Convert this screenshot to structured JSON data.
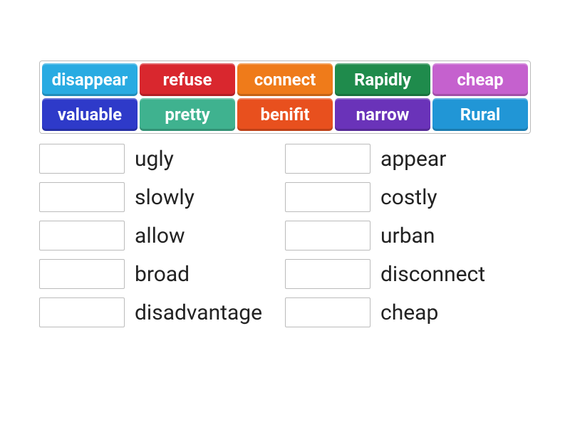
{
  "word_bank": {
    "rows": [
      [
        {
          "label": "disappear",
          "color": "c-lightblue"
        },
        {
          "label": "refuse",
          "color": "c-red"
        },
        {
          "label": "connect",
          "color": "c-orange"
        },
        {
          "label": "Rapidly",
          "color": "c-green"
        },
        {
          "label": "cheap",
          "color": "c-magenta"
        }
      ],
      [
        {
          "label": "valuable",
          "color": "c-indigo"
        },
        {
          "label": "pretty",
          "color": "c-teal"
        },
        {
          "label": "benifit",
          "color": "c-orangered"
        },
        {
          "label": "narrow",
          "color": "c-purple"
        },
        {
          "label": "Rural",
          "color": "c-skyblue"
        }
      ]
    ]
  },
  "targets": {
    "left": [
      "ugly",
      "slowly",
      "allow",
      "broad",
      "disadvantage"
    ],
    "right": [
      "appear",
      "costly",
      "urban",
      "disconnect",
      "cheap"
    ]
  }
}
